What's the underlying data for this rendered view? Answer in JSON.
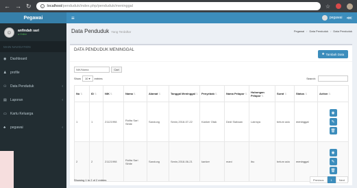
{
  "browser": {
    "url_host": "localhost",
    "url_path": "/penduduk/index.php/penduduk/meninggal"
  },
  "brand": "Pegawai",
  "user": {
    "name": "anfindah sari",
    "status": "● Online"
  },
  "sidebar": {
    "header": "MAIN NAVIGATION",
    "items": [
      {
        "label": "Dashboard",
        "icon": "dashboard-icon",
        "glyph": "◉",
        "caret": ""
      },
      {
        "label": "profile",
        "icon": "user-icon",
        "glyph": "♟",
        "caret": ""
      },
      {
        "label": "Data Penduduk",
        "icon": "users-icon",
        "glyph": "⚇",
        "caret": "‹"
      },
      {
        "label": "Laporan",
        "icon": "file-icon",
        "glyph": "▤",
        "caret": "‹"
      },
      {
        "label": "Kartu Keluarga",
        "icon": "card-icon",
        "glyph": "▭",
        "caret": ""
      },
      {
        "label": "pegawai",
        "icon": "people-icon",
        "glyph": "♣",
        "caret": "‹"
      }
    ]
  },
  "topbar": {
    "user_name": "pegawai"
  },
  "header": {
    "title": "Data Penduduk",
    "subtitle": "Yang Terdaftar",
    "breadcrumb": [
      "Pegawai",
      "Data Penduduk",
      "Data Penduduk"
    ]
  },
  "box": {
    "title": "DATA PENDUDUK MENINGGAL",
    "add_label": "Tambah Data"
  },
  "search_nik": {
    "value": "NIK/Nama",
    "button": "Cari"
  },
  "entries": {
    "prefix": "Show",
    "value": "10",
    "suffix": "entries"
  },
  "search_label": "Search:",
  "table": {
    "columns": [
      "No",
      "ID",
      "NIK",
      "Nama",
      "Alamat",
      "Tanggal Meninggal",
      "Penyebab",
      "Nama Pelapor",
      "Hubungan Pelapor",
      "Surat",
      "Status",
      "Action"
    ],
    "rows": [
      [
        "1",
        "1",
        "21121998",
        "Rolita Sari Sihite",
        "Sandung",
        "Senin,2018-07-22",
        "Kanker Otak",
        "Dedi Siahaan",
        "Lainnya",
        "belum ada",
        "meninggal"
      ],
      [
        "2",
        "2",
        "21121998",
        "Rolita Sari Sihite",
        "Sandung",
        "Senin,2018-06-21",
        "kanker",
        "mani",
        "ibu",
        "belum ada",
        "meninggal"
      ]
    ]
  },
  "showing": "Showing 1 to 2 of 2 entries",
  "pager": {
    "prev": "Previous",
    "page": "1",
    "next": "Next"
  },
  "colors": {
    "brand": "#367fa9",
    "topbar": "#3c8dbc",
    "sidebar": "#222d32"
  }
}
